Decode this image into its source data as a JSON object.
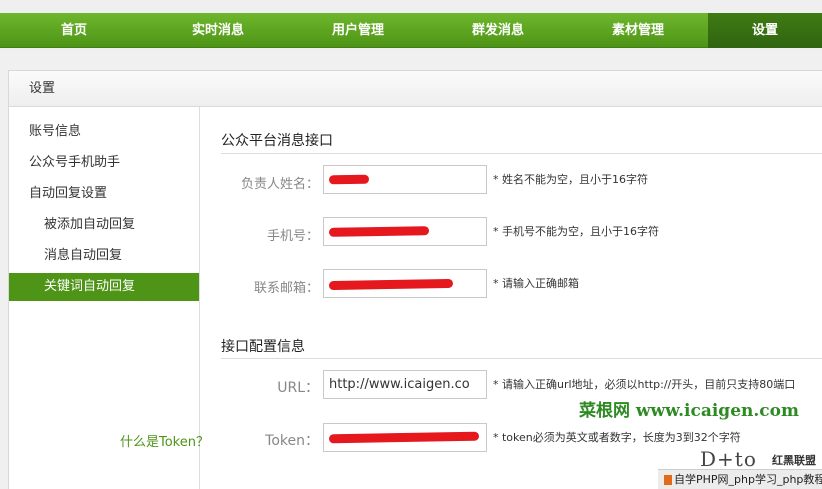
{
  "nav": {
    "items": [
      "首页",
      "实时消息",
      "用户管理",
      "群发消息",
      "素材管理",
      "设置"
    ]
  },
  "panel": {
    "title": "设置"
  },
  "sidebar": {
    "items": [
      {
        "label": "账号信息"
      },
      {
        "label": "公众号手机助手"
      },
      {
        "label": "自动回复设置"
      },
      {
        "label": "被添加自动回复"
      },
      {
        "label": "消息自动回复"
      },
      {
        "label": "关键词自动回复"
      }
    ],
    "active": "关键词自动回复"
  },
  "section1": {
    "title": "公众平台消息接口",
    "fields": [
      {
        "label": "负责人姓名：",
        "hint": "* 姓名不能为空，且小于16字符",
        "value": ""
      },
      {
        "label": "手机号：",
        "hint": "* 手机号不能为空，且小于16字符",
        "value": ""
      },
      {
        "label": "联系邮箱：",
        "hint": "* 请输入正确邮箱",
        "value": ""
      }
    ]
  },
  "watermark": "菜根网 www.icaigen.com",
  "section2": {
    "title": "接口配置信息",
    "fields": [
      {
        "label": "URL：",
        "value": "http://www.icaigen.co",
        "hint": "* 请输入正确url地址，必须以http://开头，目前只支持80端口"
      },
      {
        "label": "Token：",
        "value": "",
        "hint": "* token必须为英文或者数字，长度为3到32个字符"
      }
    ],
    "link": "什么是Token？"
  },
  "logo": {
    "mark": "D+to",
    "cn": "红黑联盟",
    "bottom": "自学PHP网_php学习_php教程"
  },
  "colors": {
    "accent": "#4e9517",
    "nav_start": "#6eb72c",
    "scribble": "#e4181d"
  }
}
